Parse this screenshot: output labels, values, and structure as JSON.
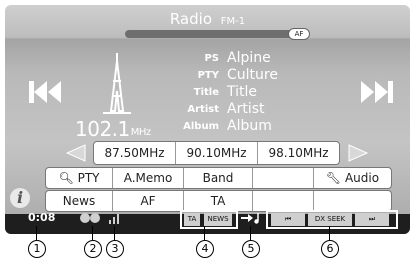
{
  "header": {
    "title": "Radio",
    "band": "FM-1",
    "af_indicator": "AF"
  },
  "tuner": {
    "frequency": "102.1",
    "unit": "MHz"
  },
  "info": [
    {
      "label": "PS",
      "value": "Alpine"
    },
    {
      "label": "PTY",
      "value": "Culture"
    },
    {
      "label": "Title",
      "value": "Title"
    },
    {
      "label": "Artist",
      "value": "Artist"
    },
    {
      "label": "Album",
      "value": "Album"
    }
  ],
  "presets": [
    "87.50MHz",
    "90.10MHz",
    "98.10MHz"
  ],
  "buttons_row1": {
    "pty": "PTY",
    "amemo": "A.Memo",
    "band": "Band",
    "audio": "Audio"
  },
  "buttons_row2": {
    "news": "News",
    "af": "AF",
    "ta": "TA"
  },
  "status": {
    "time": "0:08",
    "ta": "TA",
    "news": "NEWS",
    "seek": "DX SEEK"
  },
  "callouts": [
    "1",
    "2",
    "3",
    "4",
    "5",
    "6"
  ],
  "colors": {
    "status_bar": "#1e1e1e",
    "text_light": "#ffffff"
  },
  "icons": [
    "search-icon",
    "wrench-icon",
    "info-icon",
    "radio-tower-icon",
    "skip-back-icon",
    "skip-forward-icon",
    "music-note-icon"
  ]
}
